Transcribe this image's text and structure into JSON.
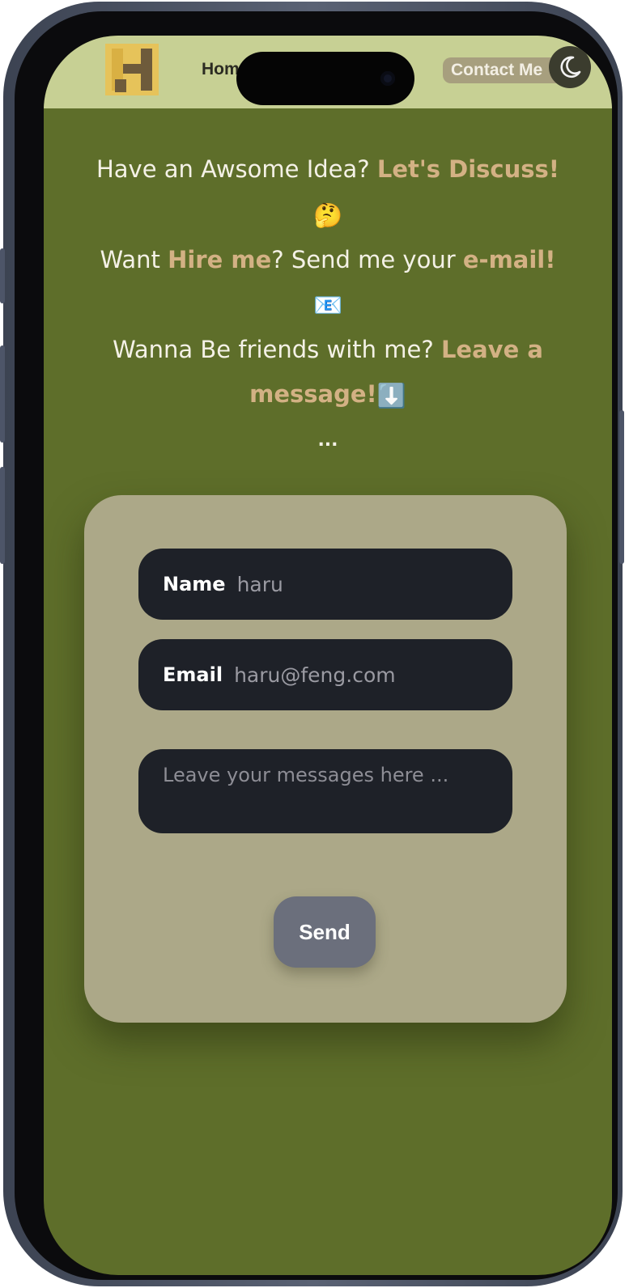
{
  "nav": {
    "home_label": "Hom",
    "contact_label": "Contact Me",
    "logo_letter": "H",
    "theme_toggle_icon": "moon-icon"
  },
  "intro": {
    "line1_text": "Have an Awsome Idea? ",
    "line1_highlight": "Let's Discuss!",
    "line1_emoji": "🤔",
    "line2_text_a": "Want ",
    "line2_highlight_a": "Hire me",
    "line2_text_b": "? Send me your ",
    "line2_highlight_b": "e-mail!",
    "line2_emoji": "📧",
    "line3_text": "Wanna Be friends with me? ",
    "line3_highlight": "Leave a message!",
    "line3_emoji": "⬇️",
    "ellipsis": "..."
  },
  "form": {
    "name_label": "Name",
    "name_value": "haru",
    "email_label": "Email",
    "email_value": "haru@feng.com",
    "message_placeholder": "Leave your messages here ...",
    "send_label": "Send"
  },
  "colors": {
    "page_background": "#5e6e2a",
    "navbar_background": "#c7d094",
    "highlight_text": "#d3b184",
    "card_background": "#aca888",
    "input_background": "#1e2128",
    "send_button": "#6b6f7c"
  }
}
